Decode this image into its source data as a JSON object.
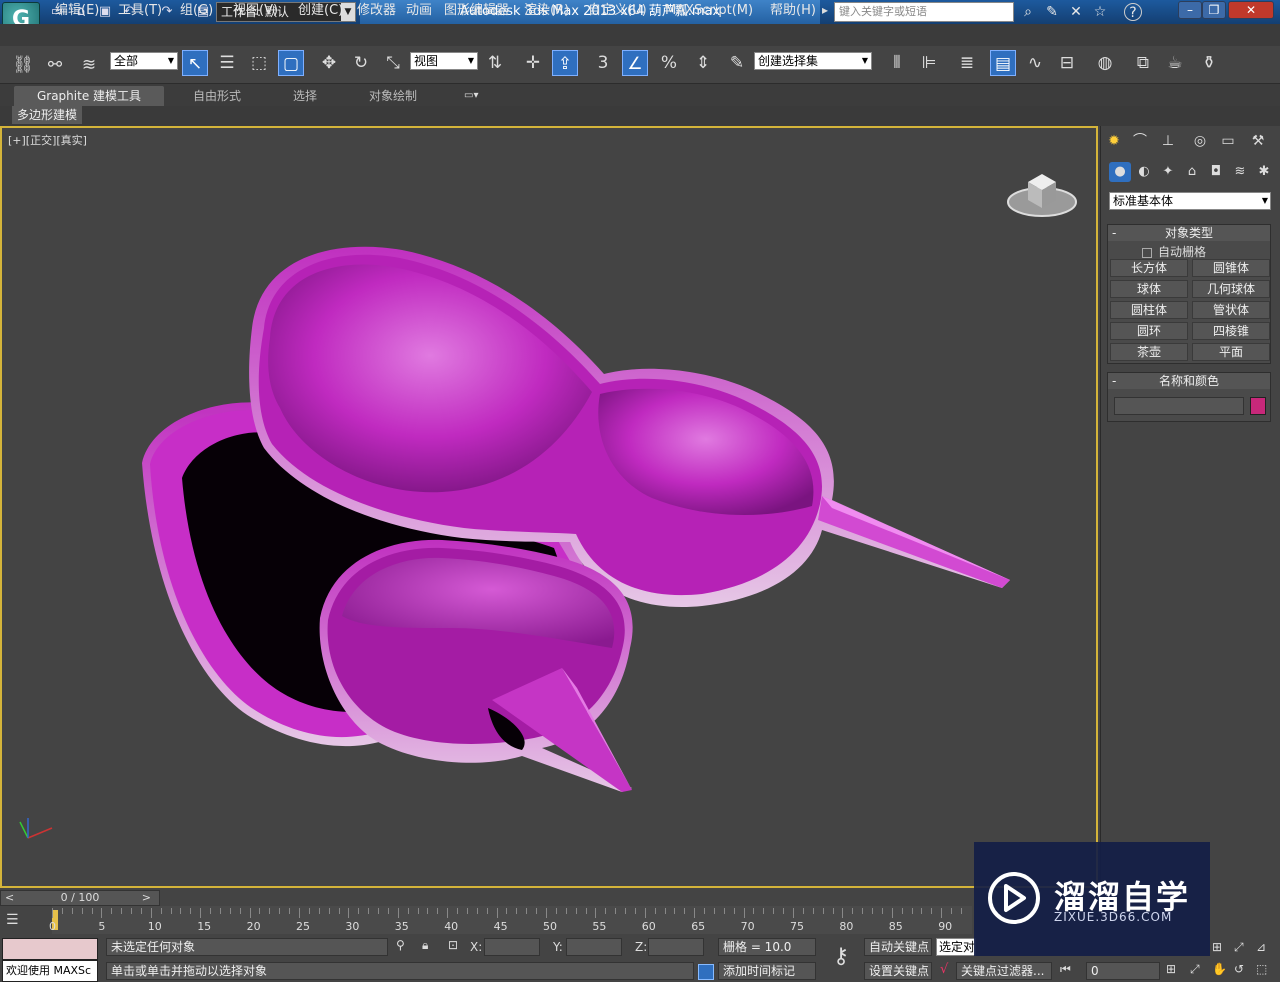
{
  "title_bar": {
    "logo": "G",
    "workspace_label": "工作台: 默认",
    "app_title": "Autodesk 3ds Max  2013 x64      葫芦瓢.max",
    "search_placeholder": "键入关键字或短语",
    "help": "?"
  },
  "menu": [
    "编辑(E)",
    "工具(T)",
    "组(G)",
    "视图(V)",
    "创建(C)",
    "修改器",
    "动画",
    "图形编辑器",
    "渲染(R)",
    "自定义(U)",
    "MAXScript(M)",
    "帮助(H)"
  ],
  "toolbar": {
    "selection_filter": "全部",
    "reference_coord": "视图",
    "named_selection_set": "创建选择集",
    "snap_number": "3"
  },
  "ribbon": {
    "tabs": [
      "Graphite 建模工具",
      "自由形式",
      "选择",
      "对象绘制"
    ],
    "sub_tab": "多边形建模"
  },
  "viewport": {
    "label": "[+][正交][真实]",
    "object_color": "#c02ac0"
  },
  "command_panel": {
    "category": "标准基本体",
    "rollout_object_type": "对象类型",
    "auto_grid": "自动栅格",
    "buttons": [
      "长方体",
      "圆锥体",
      "球体",
      "几何球体",
      "圆柱体",
      "管状体",
      "圆环",
      "四棱锥",
      "茶壶",
      "平面"
    ],
    "rollout_name_color": "名称和颜色",
    "name_value": "",
    "swatch_color": "#c8287a"
  },
  "timeline": {
    "frame_display": "0 / 100",
    "ticks": [
      "0",
      "5",
      "10",
      "15",
      "20",
      "25",
      "30",
      "35",
      "40",
      "45",
      "50",
      "55",
      "60",
      "65",
      "70",
      "75",
      "80",
      "85",
      "90"
    ]
  },
  "status": {
    "welcome": "欢迎使用 MAXSc",
    "selection": "未选定任何对象",
    "prompt": "单击或单击并拖动以选择对象",
    "x_label": "X:",
    "y_label": "Y:",
    "z_label": "Z:",
    "grid": "栅格 = 10.0",
    "auto_key": "自动关键点",
    "set_key": "设置关键点",
    "selected_dropdown": "选定对",
    "key_filters": "关键点过滤器...",
    "add_time_tag": "添加时间标记",
    "frame_value": "0"
  },
  "watermark": {
    "name": "溜溜自学",
    "url": "ZIXUE.3D66.COM"
  }
}
